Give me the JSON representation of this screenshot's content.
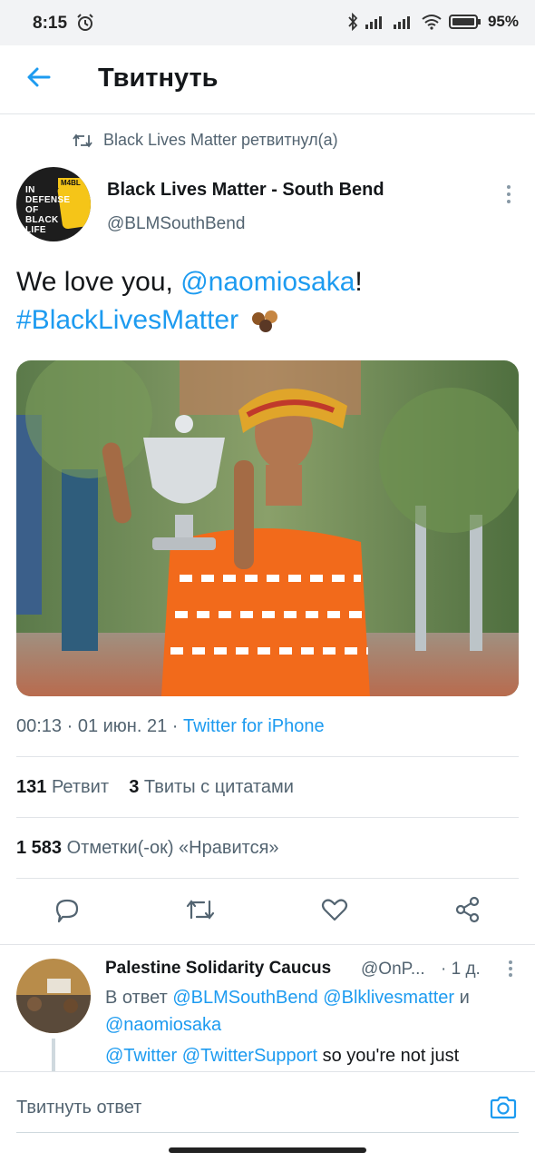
{
  "status_bar": {
    "time": "8:15",
    "battery": "95%",
    "icons": [
      "alarm-icon",
      "bluetooth-icon",
      "signal-icon",
      "signal-icon",
      "wifi-icon",
      "battery-icon"
    ]
  },
  "app_bar": {
    "title": "Твитнуть",
    "back_icon": "arrow-left-icon"
  },
  "retweet_context": {
    "icon": "retweet-icon",
    "label": "Black Lives Matter ретвитнул(а)"
  },
  "author": {
    "name": "Black Lives Matter - South Bend",
    "handle": "@BLMSouthBend",
    "avatar_text": [
      "IN",
      "DEFENSE",
      "OF",
      "BLACK",
      "LIFE"
    ],
    "avatar_tag": "M4BL"
  },
  "tweet": {
    "text_before": "We love you, ",
    "mention": "@naomiosaka",
    "text_after": "!",
    "hashtag": "#BlackLivesMatter",
    "photo_label": "tweet-photo"
  },
  "meta": {
    "time": "00:13 · 01 июн. 21 · ",
    "source": "Twitter for iPhone"
  },
  "stats": {
    "retweets_count": "131",
    "retweets_label": "Ретвит",
    "quotes_count": "3",
    "quotes_label": "Твиты с цитатами",
    "likes_count": "1 583",
    "likes_label": "Отметки(-ок) «Нравится»"
  },
  "actions": [
    "reply-icon",
    "retweet-icon",
    "like-icon",
    "share-icon"
  ],
  "reply": {
    "name": "Palestine Solidarity Caucus",
    "handle": "@OnP...",
    "time": "· 1 д.",
    "reply_prefix": "В ответ ",
    "mention1": "@BLMSouthBend",
    "mention2": "@Blklivesmatter",
    "and": " и",
    "mention3": "@naomiosaka",
    "mention4": "@Twitter",
    "mention5": "@TwitterSupport",
    "text": " so you're not just"
  },
  "compose": {
    "placeholder": "Твитнуть ответ",
    "camera_icon": "camera-icon"
  },
  "colors": {
    "accent": "#1d9bf0",
    "text_primary": "#14171a",
    "text_secondary": "#536471"
  }
}
